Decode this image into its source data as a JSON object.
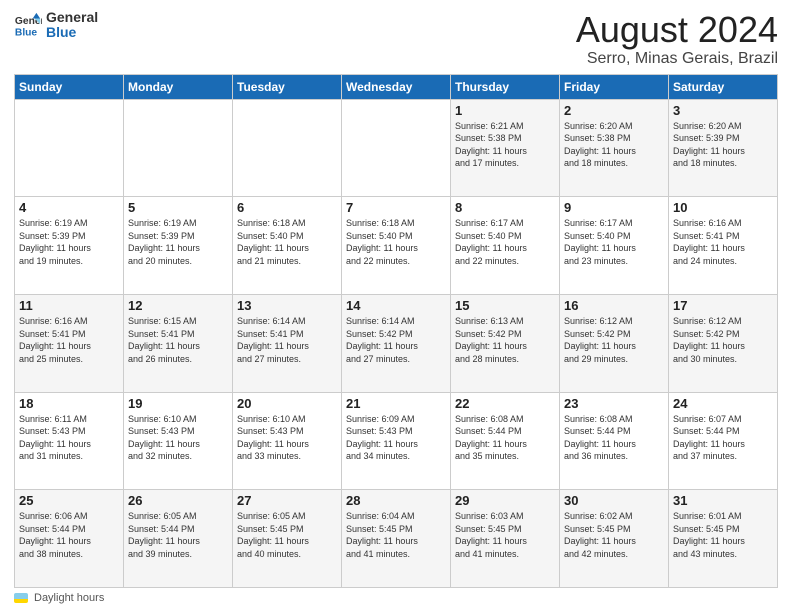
{
  "logo": {
    "line1": "General",
    "line2": "Blue"
  },
  "title": "August 2024",
  "subtitle": "Serro, Minas Gerais, Brazil",
  "days_of_week": [
    "Sunday",
    "Monday",
    "Tuesday",
    "Wednesday",
    "Thursday",
    "Friday",
    "Saturday"
  ],
  "footer_label": "Daylight hours",
  "weeks": [
    [
      {
        "day": "",
        "info": ""
      },
      {
        "day": "",
        "info": ""
      },
      {
        "day": "",
        "info": ""
      },
      {
        "day": "",
        "info": ""
      },
      {
        "day": "1",
        "info": "Sunrise: 6:21 AM\nSunset: 5:38 PM\nDaylight: 11 hours\nand 17 minutes."
      },
      {
        "day": "2",
        "info": "Sunrise: 6:20 AM\nSunset: 5:38 PM\nDaylight: 11 hours\nand 18 minutes."
      },
      {
        "day": "3",
        "info": "Sunrise: 6:20 AM\nSunset: 5:39 PM\nDaylight: 11 hours\nand 18 minutes."
      }
    ],
    [
      {
        "day": "4",
        "info": "Sunrise: 6:19 AM\nSunset: 5:39 PM\nDaylight: 11 hours\nand 19 minutes."
      },
      {
        "day": "5",
        "info": "Sunrise: 6:19 AM\nSunset: 5:39 PM\nDaylight: 11 hours\nand 20 minutes."
      },
      {
        "day": "6",
        "info": "Sunrise: 6:18 AM\nSunset: 5:40 PM\nDaylight: 11 hours\nand 21 minutes."
      },
      {
        "day": "7",
        "info": "Sunrise: 6:18 AM\nSunset: 5:40 PM\nDaylight: 11 hours\nand 22 minutes."
      },
      {
        "day": "8",
        "info": "Sunrise: 6:17 AM\nSunset: 5:40 PM\nDaylight: 11 hours\nand 22 minutes."
      },
      {
        "day": "9",
        "info": "Sunrise: 6:17 AM\nSunset: 5:40 PM\nDaylight: 11 hours\nand 23 minutes."
      },
      {
        "day": "10",
        "info": "Sunrise: 6:16 AM\nSunset: 5:41 PM\nDaylight: 11 hours\nand 24 minutes."
      }
    ],
    [
      {
        "day": "11",
        "info": "Sunrise: 6:16 AM\nSunset: 5:41 PM\nDaylight: 11 hours\nand 25 minutes."
      },
      {
        "day": "12",
        "info": "Sunrise: 6:15 AM\nSunset: 5:41 PM\nDaylight: 11 hours\nand 26 minutes."
      },
      {
        "day": "13",
        "info": "Sunrise: 6:14 AM\nSunset: 5:41 PM\nDaylight: 11 hours\nand 27 minutes."
      },
      {
        "day": "14",
        "info": "Sunrise: 6:14 AM\nSunset: 5:42 PM\nDaylight: 11 hours\nand 27 minutes."
      },
      {
        "day": "15",
        "info": "Sunrise: 6:13 AM\nSunset: 5:42 PM\nDaylight: 11 hours\nand 28 minutes."
      },
      {
        "day": "16",
        "info": "Sunrise: 6:12 AM\nSunset: 5:42 PM\nDaylight: 11 hours\nand 29 minutes."
      },
      {
        "day": "17",
        "info": "Sunrise: 6:12 AM\nSunset: 5:42 PM\nDaylight: 11 hours\nand 30 minutes."
      }
    ],
    [
      {
        "day": "18",
        "info": "Sunrise: 6:11 AM\nSunset: 5:43 PM\nDaylight: 11 hours\nand 31 minutes."
      },
      {
        "day": "19",
        "info": "Sunrise: 6:10 AM\nSunset: 5:43 PM\nDaylight: 11 hours\nand 32 minutes."
      },
      {
        "day": "20",
        "info": "Sunrise: 6:10 AM\nSunset: 5:43 PM\nDaylight: 11 hours\nand 33 minutes."
      },
      {
        "day": "21",
        "info": "Sunrise: 6:09 AM\nSunset: 5:43 PM\nDaylight: 11 hours\nand 34 minutes."
      },
      {
        "day": "22",
        "info": "Sunrise: 6:08 AM\nSunset: 5:44 PM\nDaylight: 11 hours\nand 35 minutes."
      },
      {
        "day": "23",
        "info": "Sunrise: 6:08 AM\nSunset: 5:44 PM\nDaylight: 11 hours\nand 36 minutes."
      },
      {
        "day": "24",
        "info": "Sunrise: 6:07 AM\nSunset: 5:44 PM\nDaylight: 11 hours\nand 37 minutes."
      }
    ],
    [
      {
        "day": "25",
        "info": "Sunrise: 6:06 AM\nSunset: 5:44 PM\nDaylight: 11 hours\nand 38 minutes."
      },
      {
        "day": "26",
        "info": "Sunrise: 6:05 AM\nSunset: 5:44 PM\nDaylight: 11 hours\nand 39 minutes."
      },
      {
        "day": "27",
        "info": "Sunrise: 6:05 AM\nSunset: 5:45 PM\nDaylight: 11 hours\nand 40 minutes."
      },
      {
        "day": "28",
        "info": "Sunrise: 6:04 AM\nSunset: 5:45 PM\nDaylight: 11 hours\nand 41 minutes."
      },
      {
        "day": "29",
        "info": "Sunrise: 6:03 AM\nSunset: 5:45 PM\nDaylight: 11 hours\nand 41 minutes."
      },
      {
        "day": "30",
        "info": "Sunrise: 6:02 AM\nSunset: 5:45 PM\nDaylight: 11 hours\nand 42 minutes."
      },
      {
        "day": "31",
        "info": "Sunrise: 6:01 AM\nSunset: 5:45 PM\nDaylight: 11 hours\nand 43 minutes."
      }
    ]
  ]
}
